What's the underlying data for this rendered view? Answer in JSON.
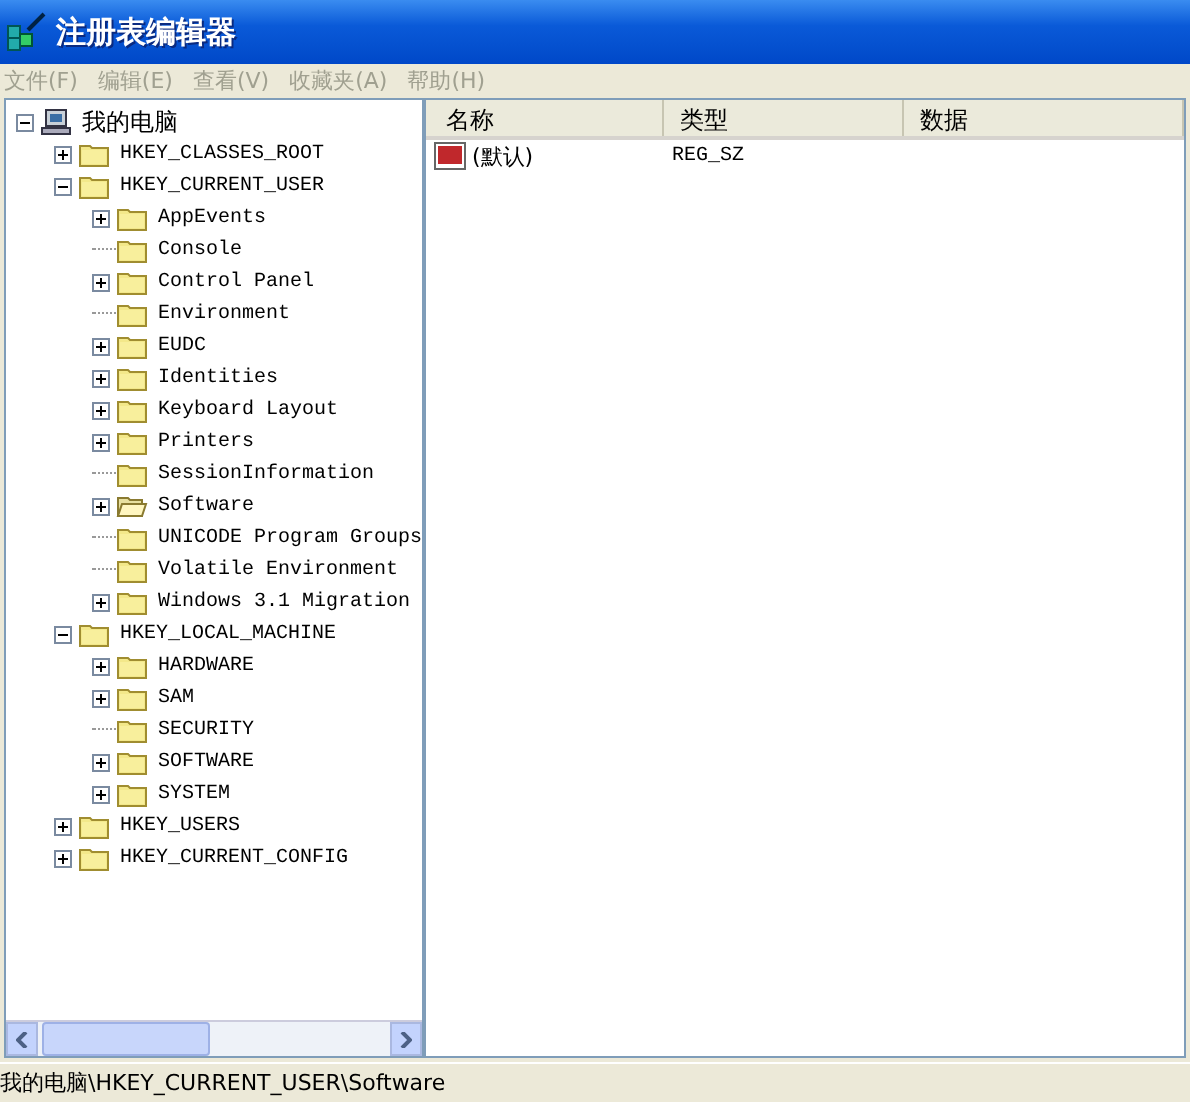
{
  "window": {
    "title": "注册表编辑器"
  },
  "menu": [
    {
      "label": "文件(F)",
      "disabled": true
    },
    {
      "label": "编辑(E)",
      "disabled": true
    },
    {
      "label": "查看(V)",
      "disabled": true
    },
    {
      "label": "收藏夹(A)",
      "disabled": true
    },
    {
      "label": "帮助(H)",
      "disabled": true
    }
  ],
  "tree": [
    {
      "label": "我的电脑",
      "kind": "computer",
      "expanded": true,
      "children": [
        {
          "label": "HKEY_CLASSES_ROOT",
          "kind": "folder",
          "expanded": false,
          "selected": false
        },
        {
          "label": "HKEY_CURRENT_USER",
          "kind": "folder",
          "expanded": true,
          "selected": false,
          "children": [
            {
              "label": "AppEvents",
              "kind": "folder",
              "expanded": false,
              "selected": false
            },
            {
              "label": "Console",
              "kind": "folder",
              "selected": false
            },
            {
              "label": "Control Panel",
              "kind": "folder",
              "expanded": false,
              "selected": false
            },
            {
              "label": "Environment",
              "kind": "folder",
              "selected": false
            },
            {
              "label": "EUDC",
              "kind": "folder",
              "expanded": false,
              "selected": false
            },
            {
              "label": "Identities",
              "kind": "folder",
              "expanded": false,
              "selected": false
            },
            {
              "label": "Keyboard Layout",
              "kind": "folder",
              "expanded": false,
              "selected": false
            },
            {
              "label": "Printers",
              "kind": "folder",
              "expanded": false,
              "selected": false
            },
            {
              "label": "SessionInformation",
              "kind": "folder",
              "selected": false
            },
            {
              "label": "Software",
              "kind": "folder",
              "expanded": false,
              "selected": true
            },
            {
              "label": "UNICODE Program Groups",
              "kind": "folder",
              "selected": false
            },
            {
              "label": "Volatile Environment",
              "kind": "folder",
              "selected": false
            },
            {
              "label": "Windows 3.1 Migration",
              "kind": "folder",
              "expanded": false,
              "selected": false
            }
          ]
        },
        {
          "label": "HKEY_LOCAL_MACHINE",
          "kind": "folder",
          "expanded": true,
          "selected": false,
          "children": [
            {
              "label": "HARDWARE",
              "kind": "folder",
              "expanded": false,
              "selected": false
            },
            {
              "label": "SAM",
              "kind": "folder",
              "expanded": false,
              "selected": false
            },
            {
              "label": "SECURITY",
              "kind": "folder",
              "selected": false
            },
            {
              "label": "SOFTWARE",
              "kind": "folder",
              "expanded": false,
              "selected": false
            },
            {
              "label": "SYSTEM",
              "kind": "folder",
              "expanded": false,
              "selected": false
            }
          ]
        },
        {
          "label": "HKEY_USERS",
          "kind": "folder",
          "expanded": false,
          "selected": false
        },
        {
          "label": "HKEY_CURRENT_CONFIG",
          "kind": "folder",
          "expanded": false,
          "selected": false
        }
      ]
    }
  ],
  "list": {
    "columns": [
      "名称",
      "类型",
      "数据"
    ],
    "rows": [
      {
        "name": "(默认)",
        "type": "REG_SZ"
      }
    ]
  },
  "status_bar": "我的电脑\\HKEY_CURRENT_USER\\Software"
}
